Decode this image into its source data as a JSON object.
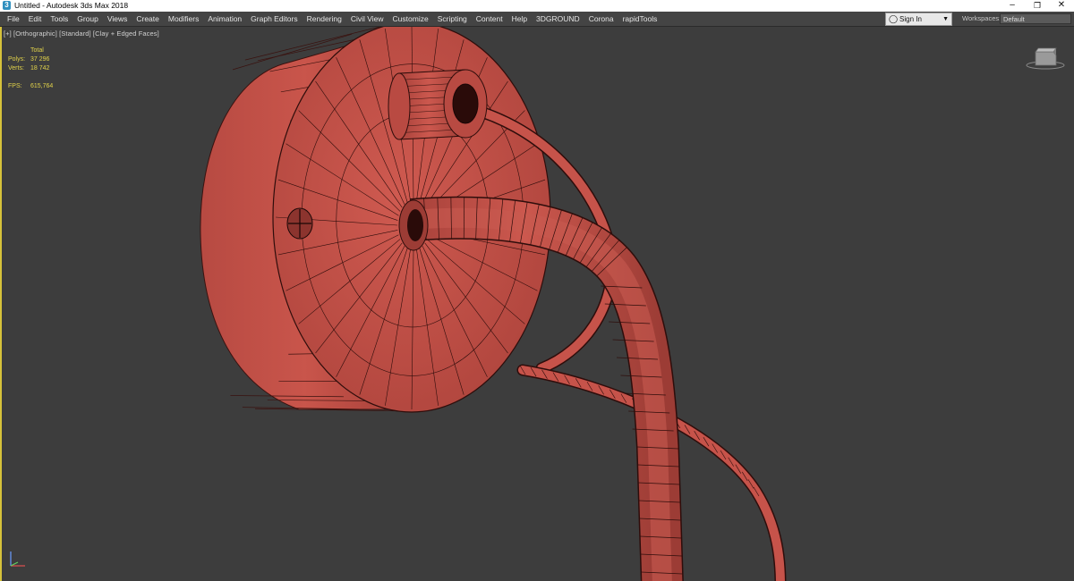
{
  "window": {
    "title": "Untitled - Autodesk 3ds Max 2018",
    "icon": "3ds-max-logo-icon",
    "controls": {
      "minimize": "–",
      "maximize": "❐",
      "close": "✕"
    }
  },
  "menu": {
    "items": [
      "File",
      "Edit",
      "Tools",
      "Group",
      "Views",
      "Create",
      "Modifiers",
      "Animation",
      "Graph Editors",
      "Rendering",
      "Civil View",
      "Customize",
      "Scripting",
      "Content",
      "Help",
      "3DGROUND",
      "Corona",
      "rapidTools"
    ],
    "sign_in_label": "Sign In",
    "sign_in_icon": "user-icon",
    "sign_in_arrow": "▼",
    "workspaces_label": "Workspaces:",
    "workspaces_value": "Default"
  },
  "viewport": {
    "label": "[+] [Orthographic] [Standard] [Clay + Edged Faces]",
    "stats": {
      "header": "Total",
      "polys_label": "Polys:",
      "polys_value": "37 296",
      "verts_label": "Verts:",
      "verts_value": "18 742",
      "fps_label": "FPS:",
      "fps_value": "615,764"
    },
    "model_color": "#c6534a",
    "wire_color": "#2e0d0b",
    "highlight_color": "#e0c84a"
  }
}
